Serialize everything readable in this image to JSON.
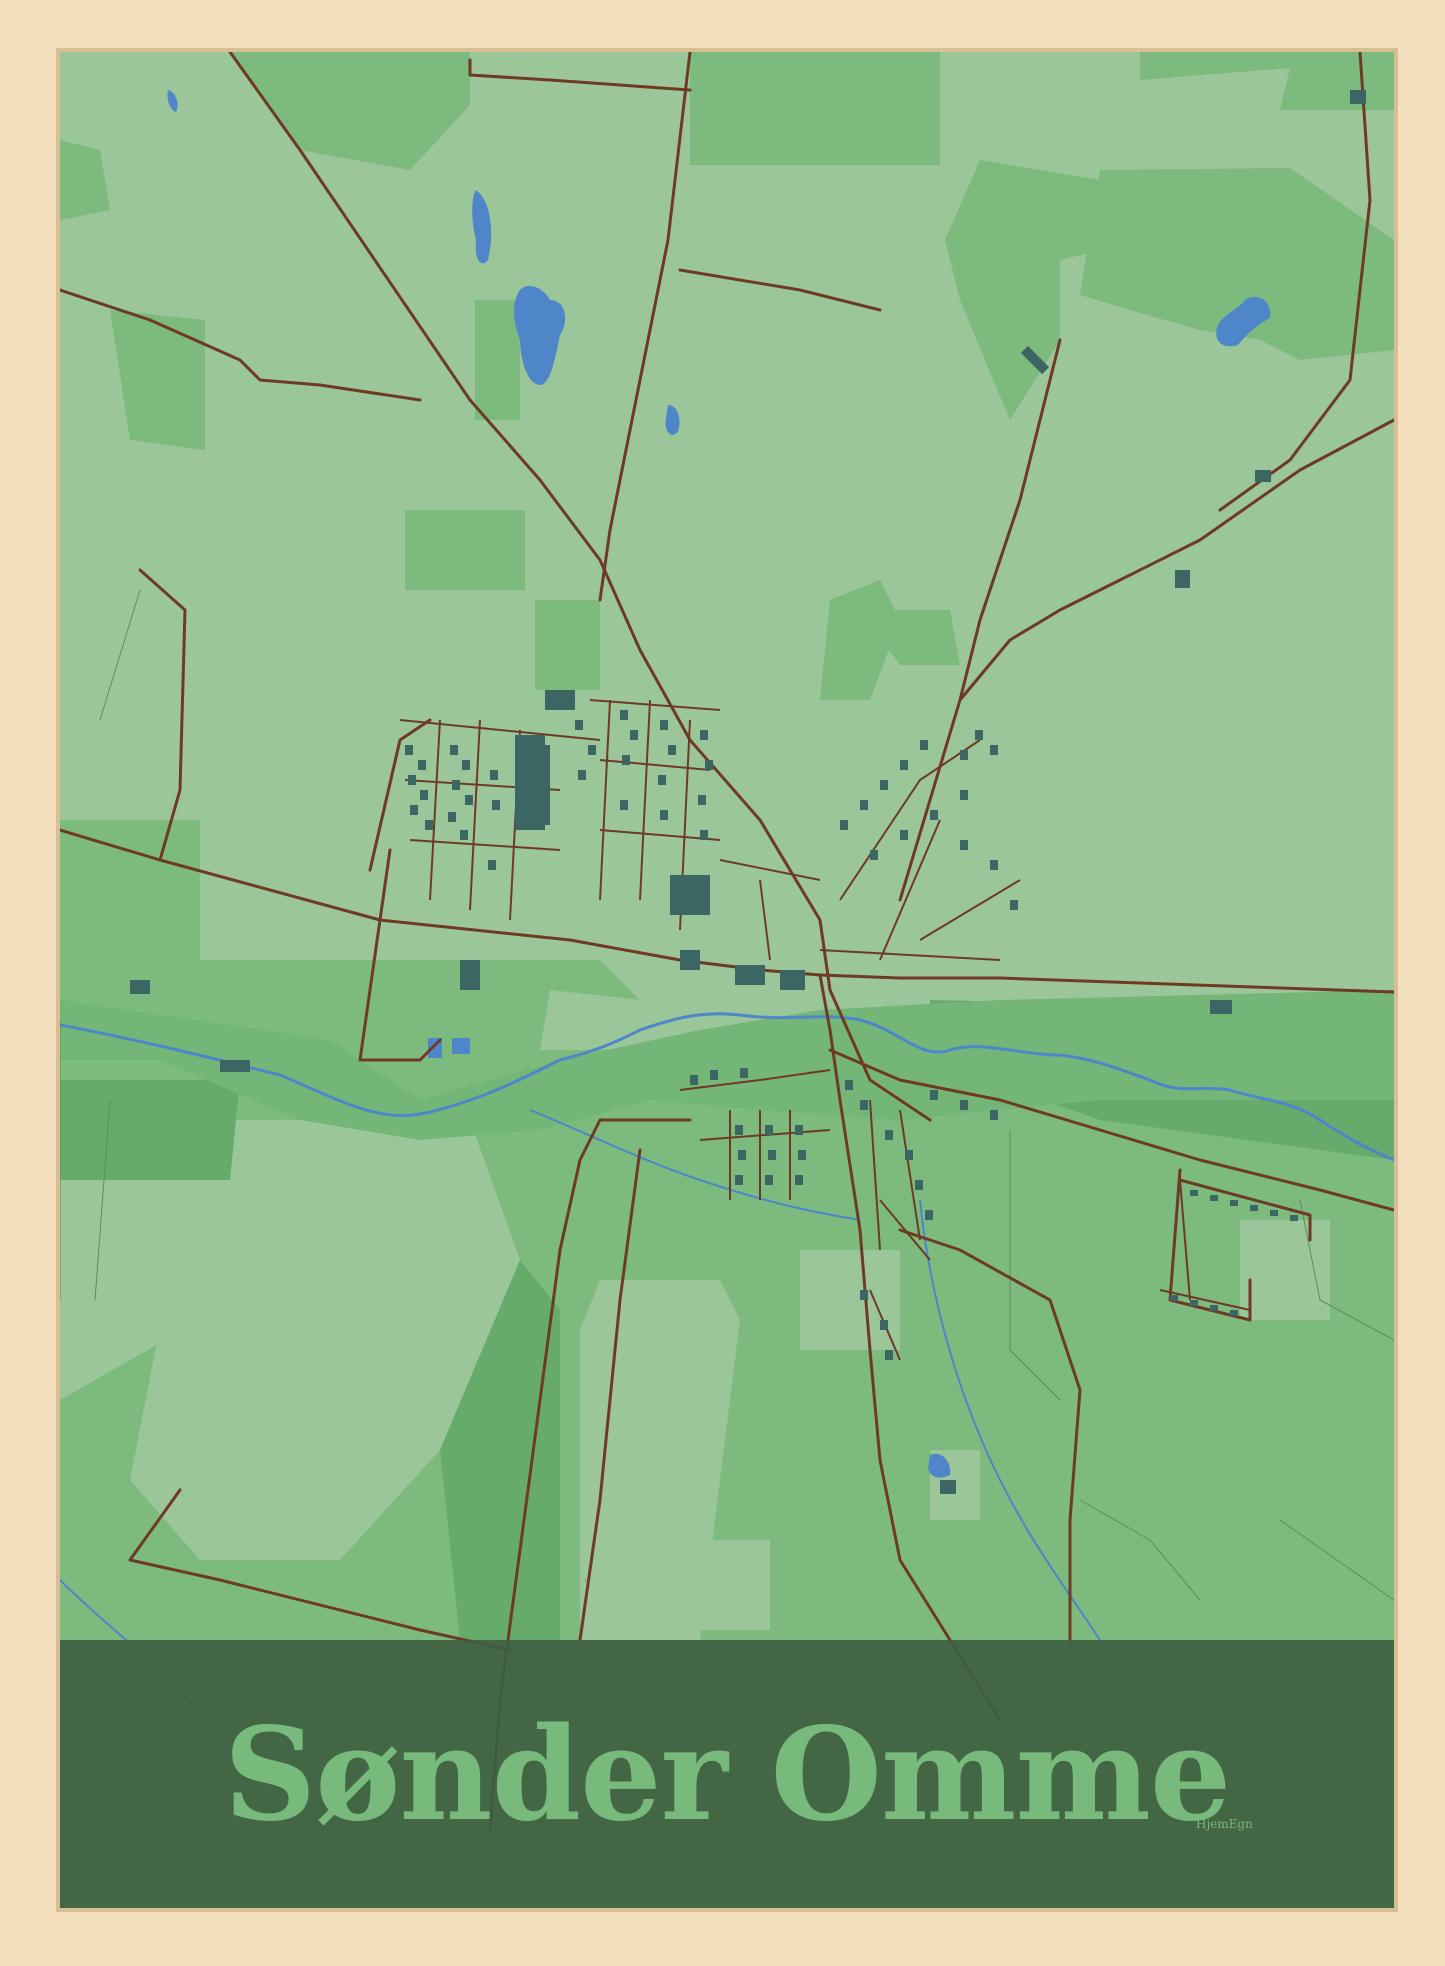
{
  "poster": {
    "title": "Sønder Omme",
    "brand": "HjemEgn"
  },
  "colors": {
    "frame_wood": "#f3dfbd",
    "frame_edge": "#e6cca1",
    "field_light": "#9bc699",
    "field_mid": "#7cba7e",
    "field_dark": "#67ab6c",
    "road": "#6e3a25",
    "water": "#4e86c9",
    "building": "#3b6664",
    "title_band": "#3e5e40",
    "title_text": "#78b97c"
  }
}
